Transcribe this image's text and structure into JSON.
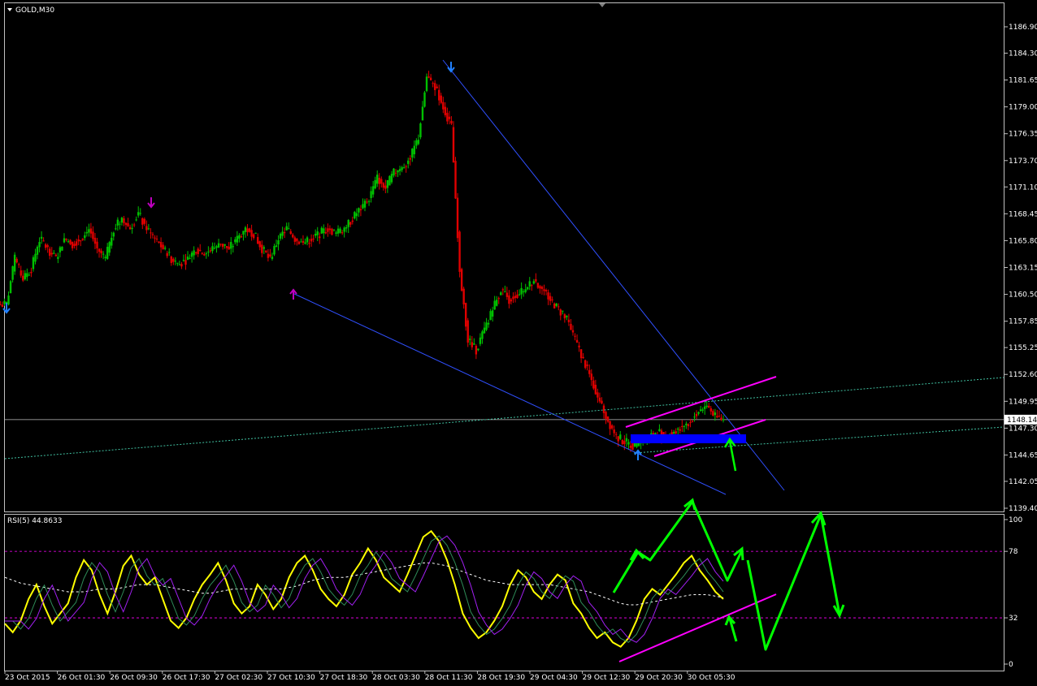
{
  "chart_data": [
    {
      "type": "candlestick",
      "title": "GOLD,M30",
      "ylim": [
        1138.3,
        1189.2
      ],
      "y_ticks": [
        "1186.90",
        "1184.30",
        "1181.65",
        "1179.00",
        "1176.35",
        "1173.70",
        "1171.10",
        "1168.45",
        "1165.80",
        "1163.15",
        "1160.50",
        "1157.85",
        "1155.25",
        "1152.60",
        "1149.95",
        "1147.30",
        "1144.65",
        "1142.05",
        "1139.40"
      ],
      "current_price": "1148.14",
      "x_ticks": [
        "23 Oct 2015",
        "26 Oct 01:30",
        "26 Oct 09:30",
        "26 Oct 17:30",
        "27 Oct 02:30",
        "27 Oct 10:30",
        "27 Oct 18:30",
        "28 Oct 03:30",
        "28 Oct 11:30",
        "28 Oct 19:30",
        "29 Oct 04:30",
        "29 Oct 12:30",
        "29 Oct 20:30",
        "30 Oct 05:30"
      ],
      "close_path": [
        1159.5,
        1164,
        1162,
        1163,
        1166,
        1165,
        1164,
        1166,
        1165.5,
        1166,
        1167,
        1165,
        1164,
        1167,
        1168,
        1167,
        1168.5,
        1167,
        1166,
        1165,
        1164,
        1163.5,
        1164,
        1165,
        1164.5,
        1165,
        1165.5,
        1165,
        1166,
        1167,
        1166.5,
        1165,
        1164,
        1166,
        1167,
        1166,
        1165.5,
        1166,
        1166.5,
        1167,
        1166.5,
        1167,
        1168,
        1169,
        1170,
        1172,
        1171,
        1172.5,
        1173,
        1174,
        1176,
        1182,
        1181,
        1179,
        1177,
        1163,
        1156,
        1155,
        1157,
        1159,
        1161,
        1160,
        1160.5,
        1161,
        1162,
        1161,
        1160,
        1159,
        1158,
        1156,
        1154,
        1152,
        1150,
        1148,
        1146.5,
        1146,
        1145.5,
        1146,
        1146.5,
        1147,
        1146.5,
        1147,
        1147.5,
        1148,
        1149,
        1149.5,
        1148.5,
        1148.14
      ],
      "annotations": {
        "arrows_down": [
          [
            150,
            1167.6
          ],
          [
            466,
            1181.7
          ]
        ],
        "arrows_up": [
          [
            302,
            1160.6
          ],
          [
            655,
            1144.9
          ]
        ]
      }
    },
    {
      "type": "line",
      "title": "RSI(5) 44.8633",
      "ylim": [
        0,
        100
      ],
      "y_ticks": [
        "100",
        "78",
        "32",
        "0"
      ],
      "levels": [
        78,
        32
      ],
      "series": [
        {
          "color": "#ffff00",
          "values": [
            28,
            22,
            30,
            45,
            55,
            40,
            28,
            35,
            42,
            60,
            72,
            65,
            48,
            35,
            50,
            68,
            75,
            62,
            55,
            60,
            45,
            30,
            25,
            32,
            45,
            55,
            62,
            70,
            58,
            42,
            35,
            40,
            55,
            48,
            38,
            45,
            60,
            70,
            75,
            65,
            52,
            45,
            40,
            48,
            62,
            70,
            80,
            72,
            60,
            55,
            50,
            62,
            75,
            88,
            92,
            85,
            72,
            55,
            35,
            25,
            18,
            22,
            30,
            40,
            55,
            65,
            60,
            50,
            45,
            55,
            62,
            58,
            42,
            35,
            25,
            18,
            22,
            15,
            12,
            18,
            30,
            45,
            52,
            48,
            55,
            62,
            70,
            75,
            65,
            58,
            50,
            45
          ]
        },
        {
          "color": "#ffffff",
          "values": [
            60,
            58,
            56,
            55,
            54,
            53,
            52,
            51,
            50,
            50,
            50,
            51,
            52,
            52,
            52,
            53,
            54,
            55,
            55,
            55,
            54,
            53,
            52,
            51,
            50,
            49,
            49,
            50,
            51,
            52,
            52,
            52,
            52,
            52,
            52,
            52,
            53,
            54,
            56,
            58,
            59,
            60,
            60,
            60,
            61,
            62,
            63,
            64,
            65,
            66,
            67,
            68,
            69,
            70,
            70,
            69,
            68,
            66,
            64,
            62,
            60,
            58,
            57,
            56,
            55,
            55,
            55,
            55,
            55,
            55,
            54,
            53,
            52,
            51,
            50,
            48,
            46,
            44,
            42,
            41,
            41,
            42,
            43,
            44,
            45,
            46,
            47,
            48,
            48,
            48,
            47,
            46
          ]
        },
        {
          "color": "#2e8b57",
          "values": []
        },
        {
          "color": "#a020f0",
          "values": []
        }
      ]
    }
  ],
  "colors": {
    "bull": "#00c000",
    "bear": "#e00000",
    "trendline": "#3050ff",
    "channel": "#ff00ff",
    "green_arrow": "#00ff00",
    "level_line": "#ff00ff"
  }
}
